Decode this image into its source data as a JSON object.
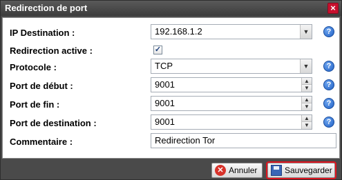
{
  "dialog": {
    "title": "Redirection de port",
    "close_glyph": "×"
  },
  "form": {
    "ip_destination": {
      "label": "IP Destination :",
      "value": "192.168.1.2"
    },
    "redirection_active": {
      "label": "Redirection active :",
      "checked": true,
      "check_glyph": "✓"
    },
    "protocole": {
      "label": "Protocole :",
      "value": "TCP"
    },
    "port_debut": {
      "label": "Port de début :",
      "value": "9001"
    },
    "port_fin": {
      "label": "Port de fin :",
      "value": "9001"
    },
    "port_destination": {
      "label": "Port de destination :",
      "value": "9001"
    },
    "commentaire": {
      "label": "Commentaire :",
      "value": "Redirection Tor"
    },
    "help_glyph": "?"
  },
  "footer": {
    "cancel_label": "Annuler",
    "save_label": "Sauvegarder"
  },
  "icons": {
    "dropdown": "chevron-down-icon",
    "spin_up": "chevron-up-icon",
    "spin_down": "chevron-down-icon",
    "help": "help-icon",
    "cancel": "cancel-icon",
    "save": "floppy-disk-icon",
    "close": "close-icon"
  },
  "colors": {
    "titlebar": "#4a4a4a",
    "help": "#1f5fc4",
    "save_highlight": "#e0141e"
  }
}
